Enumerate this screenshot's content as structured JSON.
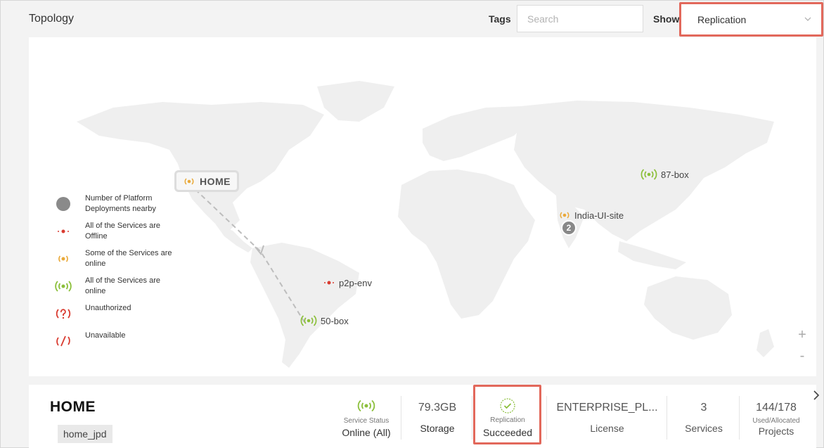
{
  "header": {
    "title": "Topology",
    "tags_label": "Tags",
    "search_placeholder": "Search",
    "show_label": "Show",
    "show_selected": "Replication"
  },
  "legend": [
    {
      "icon": "gray-dot-icon",
      "text": "Number of Platform Deployments nearby"
    },
    {
      "icon": "red-dot-icon",
      "text": "All of the Services are Offline"
    },
    {
      "icon": "orange-signal-icon",
      "text": "Some of the Services are online"
    },
    {
      "icon": "green-signal-icon",
      "text": "All of the Services are online"
    },
    {
      "icon": "red-question-icon",
      "text": "Unauthorized"
    },
    {
      "icon": "red-slash-icon",
      "text": "Unavailable"
    }
  ],
  "map": {
    "home": "HOME",
    "sites": {
      "box87": "87-box",
      "india": "India-UI-site",
      "p2p": "p2p-env",
      "box50": "50-box"
    },
    "cluster_count": "2",
    "zoom_in": "+",
    "zoom_out": "-"
  },
  "details": {
    "site_name": "HOME",
    "site_tag": "home_jpd",
    "service_status_label": "Service Status",
    "service_status_value": "Online (All)",
    "storage_value": "79.3GB",
    "storage_label": "Storage",
    "replication_label": "Replication",
    "replication_value": "Succeeded",
    "license_value": "ENTERPRISE_PL...",
    "license_label": "License",
    "services_value": "3",
    "services_label": "Services",
    "projects_value": "144/178",
    "projects_sub": "Used/Allocated",
    "projects_label": "Projects"
  },
  "colors": {
    "online": "#8bbf3a",
    "partial": "#e9a93a",
    "offline": "#d93b30",
    "highlight": "#e2685b",
    "land": "#efefef"
  }
}
